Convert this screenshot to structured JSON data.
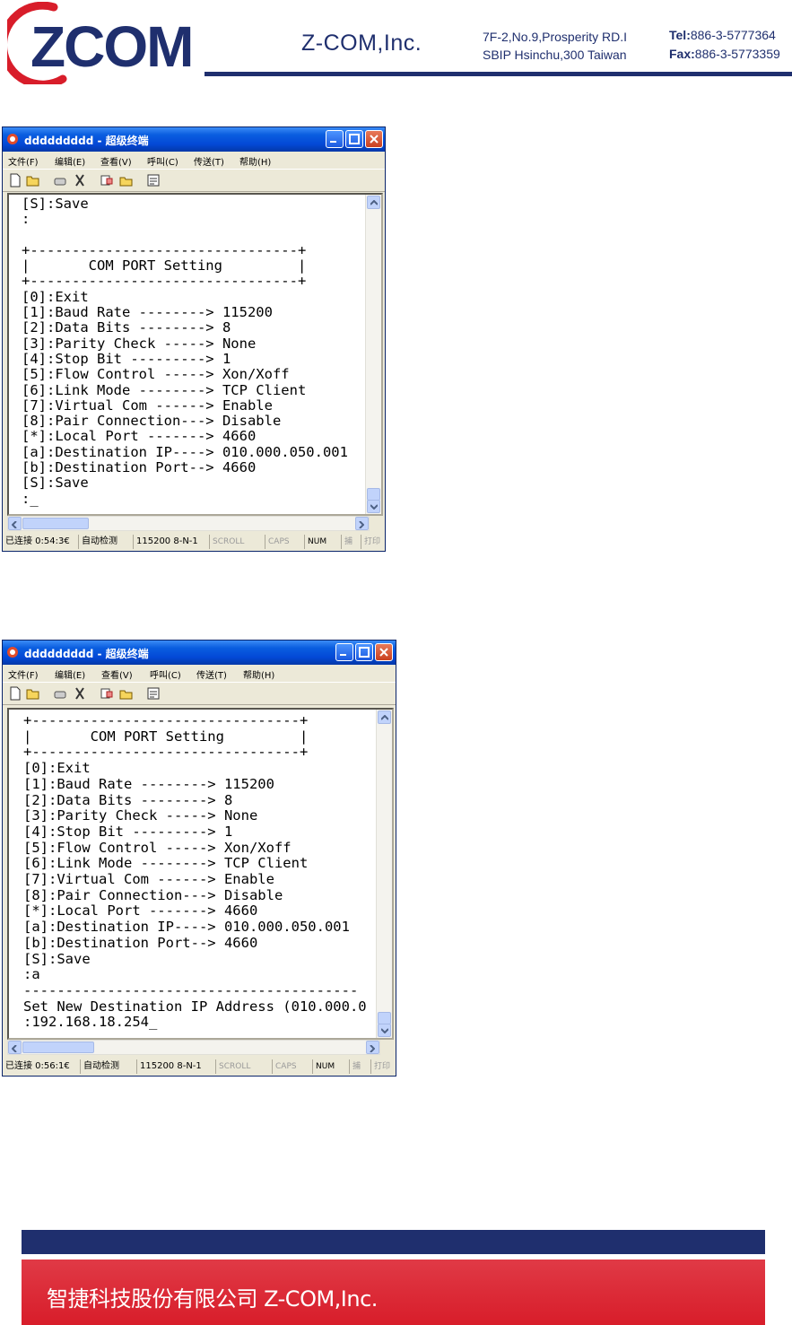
{
  "header": {
    "logo_text": "ZCOM",
    "company": "Z-COM,Inc.",
    "address_line1": "7F-2,No.9,Prosperity RD.I",
    "address_line2": "SBIP Hsinchu,300 Taiwan",
    "tel_label": "Tel:",
    "tel_value": "886-3-5777364",
    "fax_label": "Fax:",
    "fax_value": "886-3-5773359"
  },
  "window1": {
    "title": "ddddddddd - 超级终端",
    "menu": [
      "文件(F)",
      "编辑(E)",
      "查看(V)",
      "呼叫(C)",
      "传送(T)",
      "帮助(H)"
    ],
    "terminal_lines": [
      "[S]:Save",
      ":",
      "",
      "+--------------------------------+",
      "|       COM PORT Setting         |",
      "+--------------------------------+",
      "[0]:Exit",
      "[1]:Baud Rate --------> 115200",
      "[2]:Data Bits --------> 8",
      "[3]:Parity Check -----> None",
      "[4]:Stop Bit ---------> 1",
      "[5]:Flow Control -----> Xon/Xoff",
      "[6]:Link Mode --------> TCP Client",
      "[7]:Virtual Com ------> Enable",
      "[8]:Pair Connection---> Disable",
      "[*]:Local Port -------> 4660",
      "[a]:Destination IP----> 010.000.050.001",
      "[b]:Destination Port--> 4660",
      "[S]:Save",
      ":_"
    ],
    "status": {
      "connection": "已连接 0:54:3€",
      "detect": "自动检测",
      "port": "115200 8-N-1",
      "scroll": "SCROLL",
      "caps": "CAPS",
      "num": "NUM",
      "capture": "捕",
      "print": "打印"
    }
  },
  "window2": {
    "title": "ddddddddd - 超级终端",
    "menu": [
      "文件(F)",
      "编辑(E)",
      "查看(V)",
      "呼叫(C)",
      "传送(T)",
      "帮助(H)"
    ],
    "terminal_lines": [
      "+--------------------------------+",
      "|       COM PORT Setting         |",
      "+--------------------------------+",
      "[0]:Exit",
      "[1]:Baud Rate --------> 115200",
      "[2]:Data Bits --------> 8",
      "[3]:Parity Check -----> None",
      "[4]:Stop Bit ---------> 1",
      "[5]:Flow Control -----> Xon/Xoff",
      "[6]:Link Mode --------> TCP Client",
      "[7]:Virtual Com ------> Enable",
      "[8]:Pair Connection---> Disable",
      "[*]:Local Port -------> 4660",
      "[a]:Destination IP----> 010.000.050.001",
      "[b]:Destination Port--> 4660",
      "[S]:Save",
      ":a",
      "----------------------------------------",
      "Set New Destination IP Address (010.000.0",
      ":192.168.18.254_"
    ],
    "status": {
      "connection": "已连接 0:56:1€",
      "detect": "自动检测",
      "port": "115200 8-N-1",
      "scroll": "SCROLL",
      "caps": "CAPS",
      "num": "NUM",
      "capture": "捕",
      "print": "打印"
    }
  },
  "footer": {
    "text": "智捷科技股份有限公司  Z-COM,Inc."
  },
  "colors": {
    "navy": "#1f2f6e",
    "red": "#d81d2a",
    "xp_title_blue": "#0a5ee0"
  }
}
